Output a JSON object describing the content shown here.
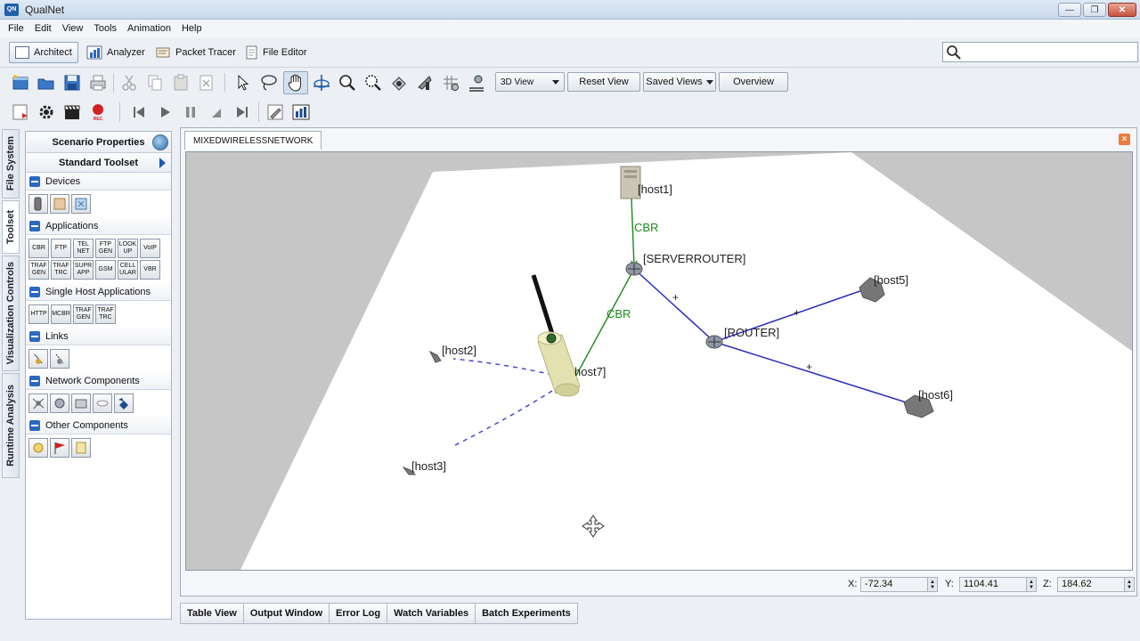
{
  "window": {
    "title": "QualNet",
    "logo_text": "QN",
    "minimize": "—",
    "maximize": "❐",
    "close": "✕"
  },
  "menu": [
    "File",
    "Edit",
    "View",
    "Tools",
    "Animation",
    "Help"
  ],
  "perspectives": {
    "architect": "Architect",
    "analyzer": "Analyzer",
    "packet_tracer": "Packet Tracer",
    "file_editor": "File Editor",
    "active": "Architect"
  },
  "search": {
    "value": ""
  },
  "toolbar": {
    "view_mode": "3D View",
    "reset_view": "Reset View",
    "saved_views": "Saved Views",
    "overview": "Overview"
  },
  "side_tabs": {
    "file_system": "File System",
    "toolset": "Toolset",
    "visualization_controls": "Visualization Controls",
    "runtime_analysis": "Runtime Analysis",
    "active": "Toolset"
  },
  "toolset_panel": {
    "header": "Scenario Properties",
    "toolset": "Standard Toolset",
    "categories": {
      "devices": "Devices",
      "applications": "Applications",
      "single_host_applications": "Single Host Applications",
      "links": "Links",
      "network_components": "Network Components",
      "other_components": "Other Components"
    },
    "applications": [
      "CBR",
      "FTP",
      "TEL NET",
      "FTP GEN",
      "LOOK UP",
      "VoIP",
      "TRAF GEN",
      "TRAF TRC",
      "SUPR APP",
      "GSM",
      "CELL ULAR",
      "VBR"
    ],
    "single_host_applications": [
      "HTTP",
      "MCBR",
      "TRAF GEN",
      "TRAF TRC"
    ]
  },
  "canvas": {
    "tab": "MIXEDWIRELESSNETWORK",
    "nodes": {
      "host1": "[host1]",
      "serverrouter": "[SERVERROUTER]",
      "router": "[ROUTER]",
      "host5": "[host5]",
      "host6": "[host6]",
      "host7": "host7]",
      "host2": "[host2]",
      "host3": "[host3]"
    },
    "links": {
      "cbr_1": "CBR",
      "cbr_2": "CBR",
      "plus_1": "+",
      "plus_2": "+",
      "plus_3": "+"
    }
  },
  "coords": {
    "x_label": "X:",
    "x": "-72.34",
    "y_label": "Y:",
    "y": "1104.41",
    "z_label": "Z:",
    "z": "184.62"
  },
  "bottom_tabs": [
    "Table View",
    "Output Window",
    "Error Log",
    "Watch Variables",
    "Batch Experiments"
  ],
  "colors": {
    "cbr_link": "#1b8a1b",
    "wired_link": "#2d2dc0",
    "wireless_link": "#3c3cd0",
    "accent": "#2b68bf"
  }
}
